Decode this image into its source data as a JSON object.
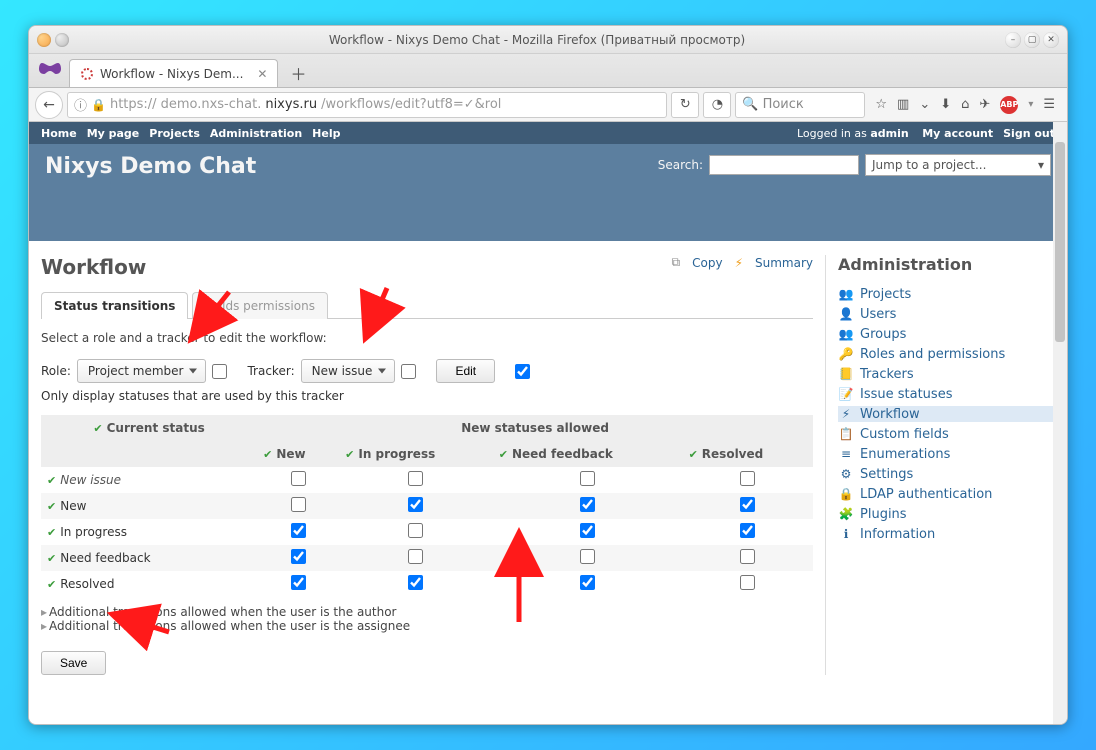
{
  "window": {
    "title": "Workflow - Nixys Demo Chat - Mozilla Firefox (Приватный просмотр)"
  },
  "browser": {
    "tab_title": "Workflow - Nixys Dem...",
    "url_proto": "https://",
    "url_sub": "demo.nxs-chat.",
    "url_domain": "nixys.ru",
    "url_path": "/workflows/edit?utf8=✓&rol",
    "search_placeholder": "Поиск"
  },
  "topmenu": {
    "left": [
      "Home",
      "My page",
      "Projects",
      "Administration",
      "Help"
    ],
    "logged_in_prefix": "Logged in as ",
    "logged_in_user": "admin",
    "right": [
      "My account",
      "Sign out"
    ]
  },
  "header": {
    "title": "Nixys Demo Chat",
    "search_label": "Search:",
    "project_jump": "Jump to a project..."
  },
  "page": {
    "title": "Workflow",
    "copy": "Copy",
    "summary": "Summary",
    "tab_active": "Status transitions",
    "tab_inactive": "Fields permissions",
    "instruction": "Select a role and a tracker to edit the workflow:",
    "role_label": "Role:",
    "role_value": "Project member",
    "tracker_label": "Tracker:",
    "tracker_value": "New issue",
    "edit_btn": "Edit",
    "only_display": "Only display statuses that are used by this tracker",
    "col_current": "Current status",
    "col_new": "New statuses allowed",
    "statuses": [
      "New",
      "In progress",
      "Need feedback",
      "Resolved"
    ],
    "rows": [
      {
        "name": "New issue",
        "italic": true,
        "checks": [
          false,
          false,
          false,
          false
        ]
      },
      {
        "name": "New",
        "italic": false,
        "checks": [
          false,
          true,
          true,
          true
        ]
      },
      {
        "name": "In progress",
        "italic": false,
        "checks": [
          true,
          false,
          true,
          true
        ]
      },
      {
        "name": "Need feedback",
        "italic": false,
        "checks": [
          true,
          false,
          false,
          false
        ]
      },
      {
        "name": "Resolved",
        "italic": false,
        "checks": [
          true,
          true,
          true,
          false
        ]
      }
    ],
    "additional1": "Additional transitions allowed when the user is the author",
    "additional2": "Additional transitions allowed when the user is the assignee",
    "save_btn": "Save"
  },
  "sidebar": {
    "title": "Administration",
    "items": [
      {
        "icon": "👥",
        "label": "Projects"
      },
      {
        "icon": "👤",
        "label": "Users"
      },
      {
        "icon": "👥",
        "label": "Groups"
      },
      {
        "icon": "🔑",
        "label": "Roles and permissions"
      },
      {
        "icon": "📒",
        "label": "Trackers"
      },
      {
        "icon": "📝",
        "label": "Issue statuses"
      },
      {
        "icon": "⚡",
        "label": "Workflow",
        "active": true
      },
      {
        "icon": "📋",
        "label": "Custom fields"
      },
      {
        "icon": "≡",
        "label": "Enumerations"
      },
      {
        "icon": "⚙",
        "label": "Settings"
      },
      {
        "icon": "🔒",
        "label": "LDAP authentication"
      },
      {
        "icon": "🧩",
        "label": "Plugins"
      },
      {
        "icon": "ℹ",
        "label": "Information"
      }
    ]
  }
}
